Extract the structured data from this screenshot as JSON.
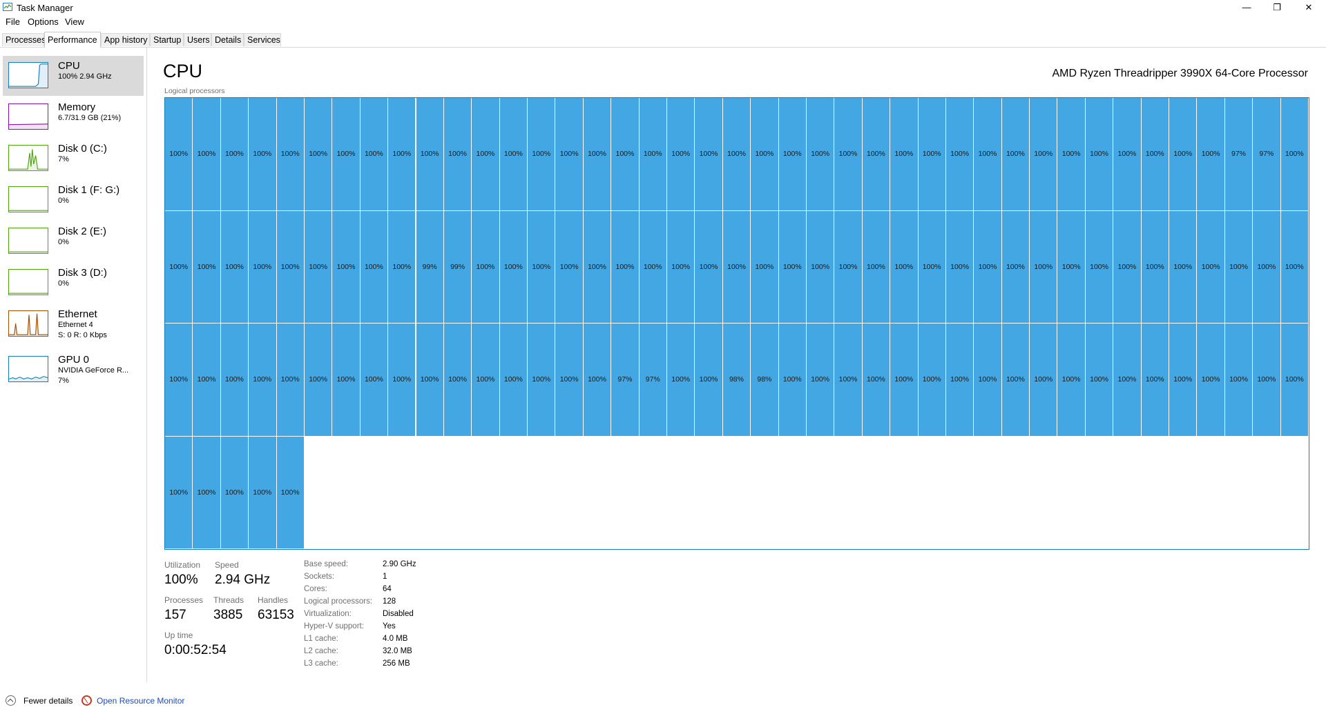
{
  "window": {
    "title": "Task Manager",
    "controls": {
      "minimize": "—",
      "maximize": "❐",
      "close": "✕"
    }
  },
  "menu": [
    "File",
    "Options",
    "View"
  ],
  "tabs": [
    {
      "label": "Processes",
      "active": false
    },
    {
      "label": "Performance",
      "active": true
    },
    {
      "label": "App history",
      "active": false
    },
    {
      "label": "Startup",
      "active": false
    },
    {
      "label": "Users",
      "active": false
    },
    {
      "label": "Details",
      "active": false
    },
    {
      "label": "Services",
      "active": false
    }
  ],
  "sidebar": [
    {
      "name": "CPU",
      "sub": [
        "100%  2.94 GHz"
      ],
      "color": "#117dbb",
      "active": true,
      "icon": "cpu-graph-icon"
    },
    {
      "name": "Memory",
      "sub": [
        "6.7/31.9 GB (21%)"
      ],
      "color": "#8b12ae",
      "active": false,
      "icon": "memory-graph-icon"
    },
    {
      "name": "Disk 0 (C:)",
      "sub": [
        "7%"
      ],
      "color": "#4da60c",
      "active": false,
      "icon": "disk-graph-icon"
    },
    {
      "name": "Disk 1 (F: G:)",
      "sub": [
        "0%"
      ],
      "color": "#4da60c",
      "active": false,
      "icon": "disk-graph-icon"
    },
    {
      "name": "Disk 2 (E:)",
      "sub": [
        "0%"
      ],
      "color": "#4da60c",
      "active": false,
      "icon": "disk-graph-icon"
    },
    {
      "name": "Disk 3 (D:)",
      "sub": [
        "0%"
      ],
      "color": "#4da60c",
      "active": false,
      "icon": "disk-graph-icon"
    },
    {
      "name": "Ethernet",
      "sub": [
        "Ethernet 4",
        "S: 0 R: 0 Kbps"
      ],
      "color": "#a74f01",
      "active": false,
      "icon": "network-graph-icon"
    },
    {
      "name": "GPU 0",
      "sub": [
        "NVIDIA GeForce R...",
        "7%"
      ],
      "color": "#117dbb",
      "active": false,
      "icon": "gpu-graph-icon"
    }
  ],
  "main": {
    "title": "CPU",
    "model": "AMD Ryzen Threadripper 3990X 64-Core Processor",
    "grid_label": "Logical processors",
    "cell_color": "#43a7e4",
    "border_color": "#117dbb"
  },
  "cores": [
    "100%",
    "100%",
    "100%",
    "100%",
    "100%",
    "100%",
    "100%",
    "100%",
    "100%",
    "100%",
    "100%",
    "100%",
    "100%",
    "100%",
    "100%",
    "100%",
    "100%",
    "100%",
    "100%",
    "100%",
    "100%",
    "100%",
    "100%",
    "100%",
    "100%",
    "100%",
    "100%",
    "100%",
    "100%",
    "100%",
    "100%",
    "100%",
    "100%",
    "100%",
    "100%",
    "100%",
    "100%",
    "100%",
    "97%",
    "97%",
    "100%",
    "100%",
    "100%",
    "100%",
    "100%",
    "100%",
    "100%",
    "100%",
    "100%",
    "100%",
    "99%",
    "99%",
    "100%",
    "100%",
    "100%",
    "100%",
    "100%",
    "100%",
    "100%",
    "100%",
    "100%",
    "100%",
    "100%",
    "100%",
    "100%",
    "100%",
    "100%",
    "100%",
    "100%",
    "100%",
    "100%",
    "100%",
    "100%",
    "100%",
    "100%",
    "100%",
    "100%",
    "100%",
    "100%",
    "100%",
    "100%",
    "100%",
    "100%",
    "100%",
    "100%",
    "100%",
    "100%",
    "100%",
    "100%",
    "100%",
    "100%",
    "100%",
    "100%",
    "100%",
    "100%",
    "100%",
    "100%",
    "100%",
    "97%",
    "97%",
    "100%",
    "100%",
    "98%",
    "98%",
    "100%",
    "100%",
    "100%",
    "100%",
    "100%",
    "100%",
    "100%",
    "100%",
    "100%",
    "100%",
    "100%",
    "100%",
    "100%",
    "100%",
    "100%",
    "100%",
    "100%",
    "100%",
    "100%",
    "100%",
    "100%",
    "100%",
    "100%",
    "100%"
  ],
  "stats": {
    "utilization": {
      "label": "Utilization",
      "value": "100%"
    },
    "speed": {
      "label": "Speed",
      "value": "2.94 GHz"
    },
    "processes": {
      "label": "Processes",
      "value": "157"
    },
    "threads": {
      "label": "Threads",
      "value": "3885"
    },
    "handles": {
      "label": "Handles",
      "value": "63153"
    },
    "uptime": {
      "label": "Up time",
      "value": "0:00:52:54"
    }
  },
  "specs": [
    {
      "label": "Base speed:",
      "value": "2.90 GHz"
    },
    {
      "label": "Sockets:",
      "value": "1"
    },
    {
      "label": "Cores:",
      "value": "64"
    },
    {
      "label": "Logical processors:",
      "value": "128"
    },
    {
      "label": "Virtualization:",
      "value": "Disabled"
    },
    {
      "label": "Hyper-V support:",
      "value": "Yes"
    },
    {
      "label": "L1 cache:",
      "value": "4.0 MB"
    },
    {
      "label": "L2 cache:",
      "value": "32.0 MB"
    },
    {
      "label": "L3 cache:",
      "value": "256 MB"
    }
  ],
  "footer": {
    "fewer_details": "Fewer details",
    "resource_monitor": "Open Resource Monitor"
  }
}
